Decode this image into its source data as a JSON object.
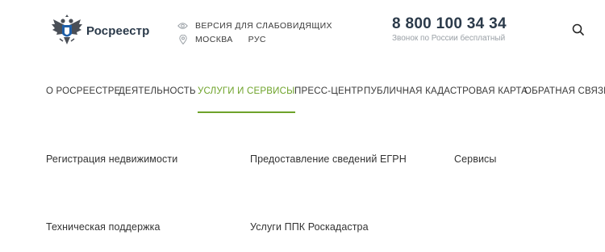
{
  "header": {
    "logo_text": "Росреестр",
    "accessibility_label": "ВЕРСИЯ ДЛЯ СЛАБОВИДЯЩИХ",
    "city": "МОСКВА",
    "language": "РУС",
    "phone": "8 800 100 34 34",
    "phone_note": "Звонок по России бесплатный"
  },
  "nav": {
    "items": [
      {
        "label": "О РОСРЕЕСТРЕ",
        "active": false
      },
      {
        "label": "ДЕЯТЕЛЬНОСТЬ",
        "active": false
      },
      {
        "label": "УСЛУГИ И СЕРВИСЫ",
        "active": true
      },
      {
        "label": "ПРЕСС-ЦЕНТР",
        "active": false
      },
      {
        "label": "ПУБЛИЧНАЯ КАДАСТРОВАЯ КАРТА",
        "active": false
      },
      {
        "label": "ОБРАТНАЯ СВЯЗЬ",
        "active": false
      }
    ]
  },
  "submenu": {
    "items": [
      {
        "label": "Регистрация недвижимости"
      },
      {
        "label": "Предоставление сведений ЕГРН"
      },
      {
        "label": "Сервисы"
      },
      {
        "label": "Техническая поддержка"
      },
      {
        "label": "Услуги ППК Роскадастра"
      }
    ]
  },
  "colors": {
    "accent": "#6ea32a",
    "text": "#333333",
    "muted": "#9aa0a6",
    "brand_dark": "#2b3a4a"
  },
  "icons": {
    "logo": "double-headed-eagle-emblem",
    "accessibility": "eye-icon",
    "location": "location-pin-icon",
    "search": "search-icon"
  }
}
